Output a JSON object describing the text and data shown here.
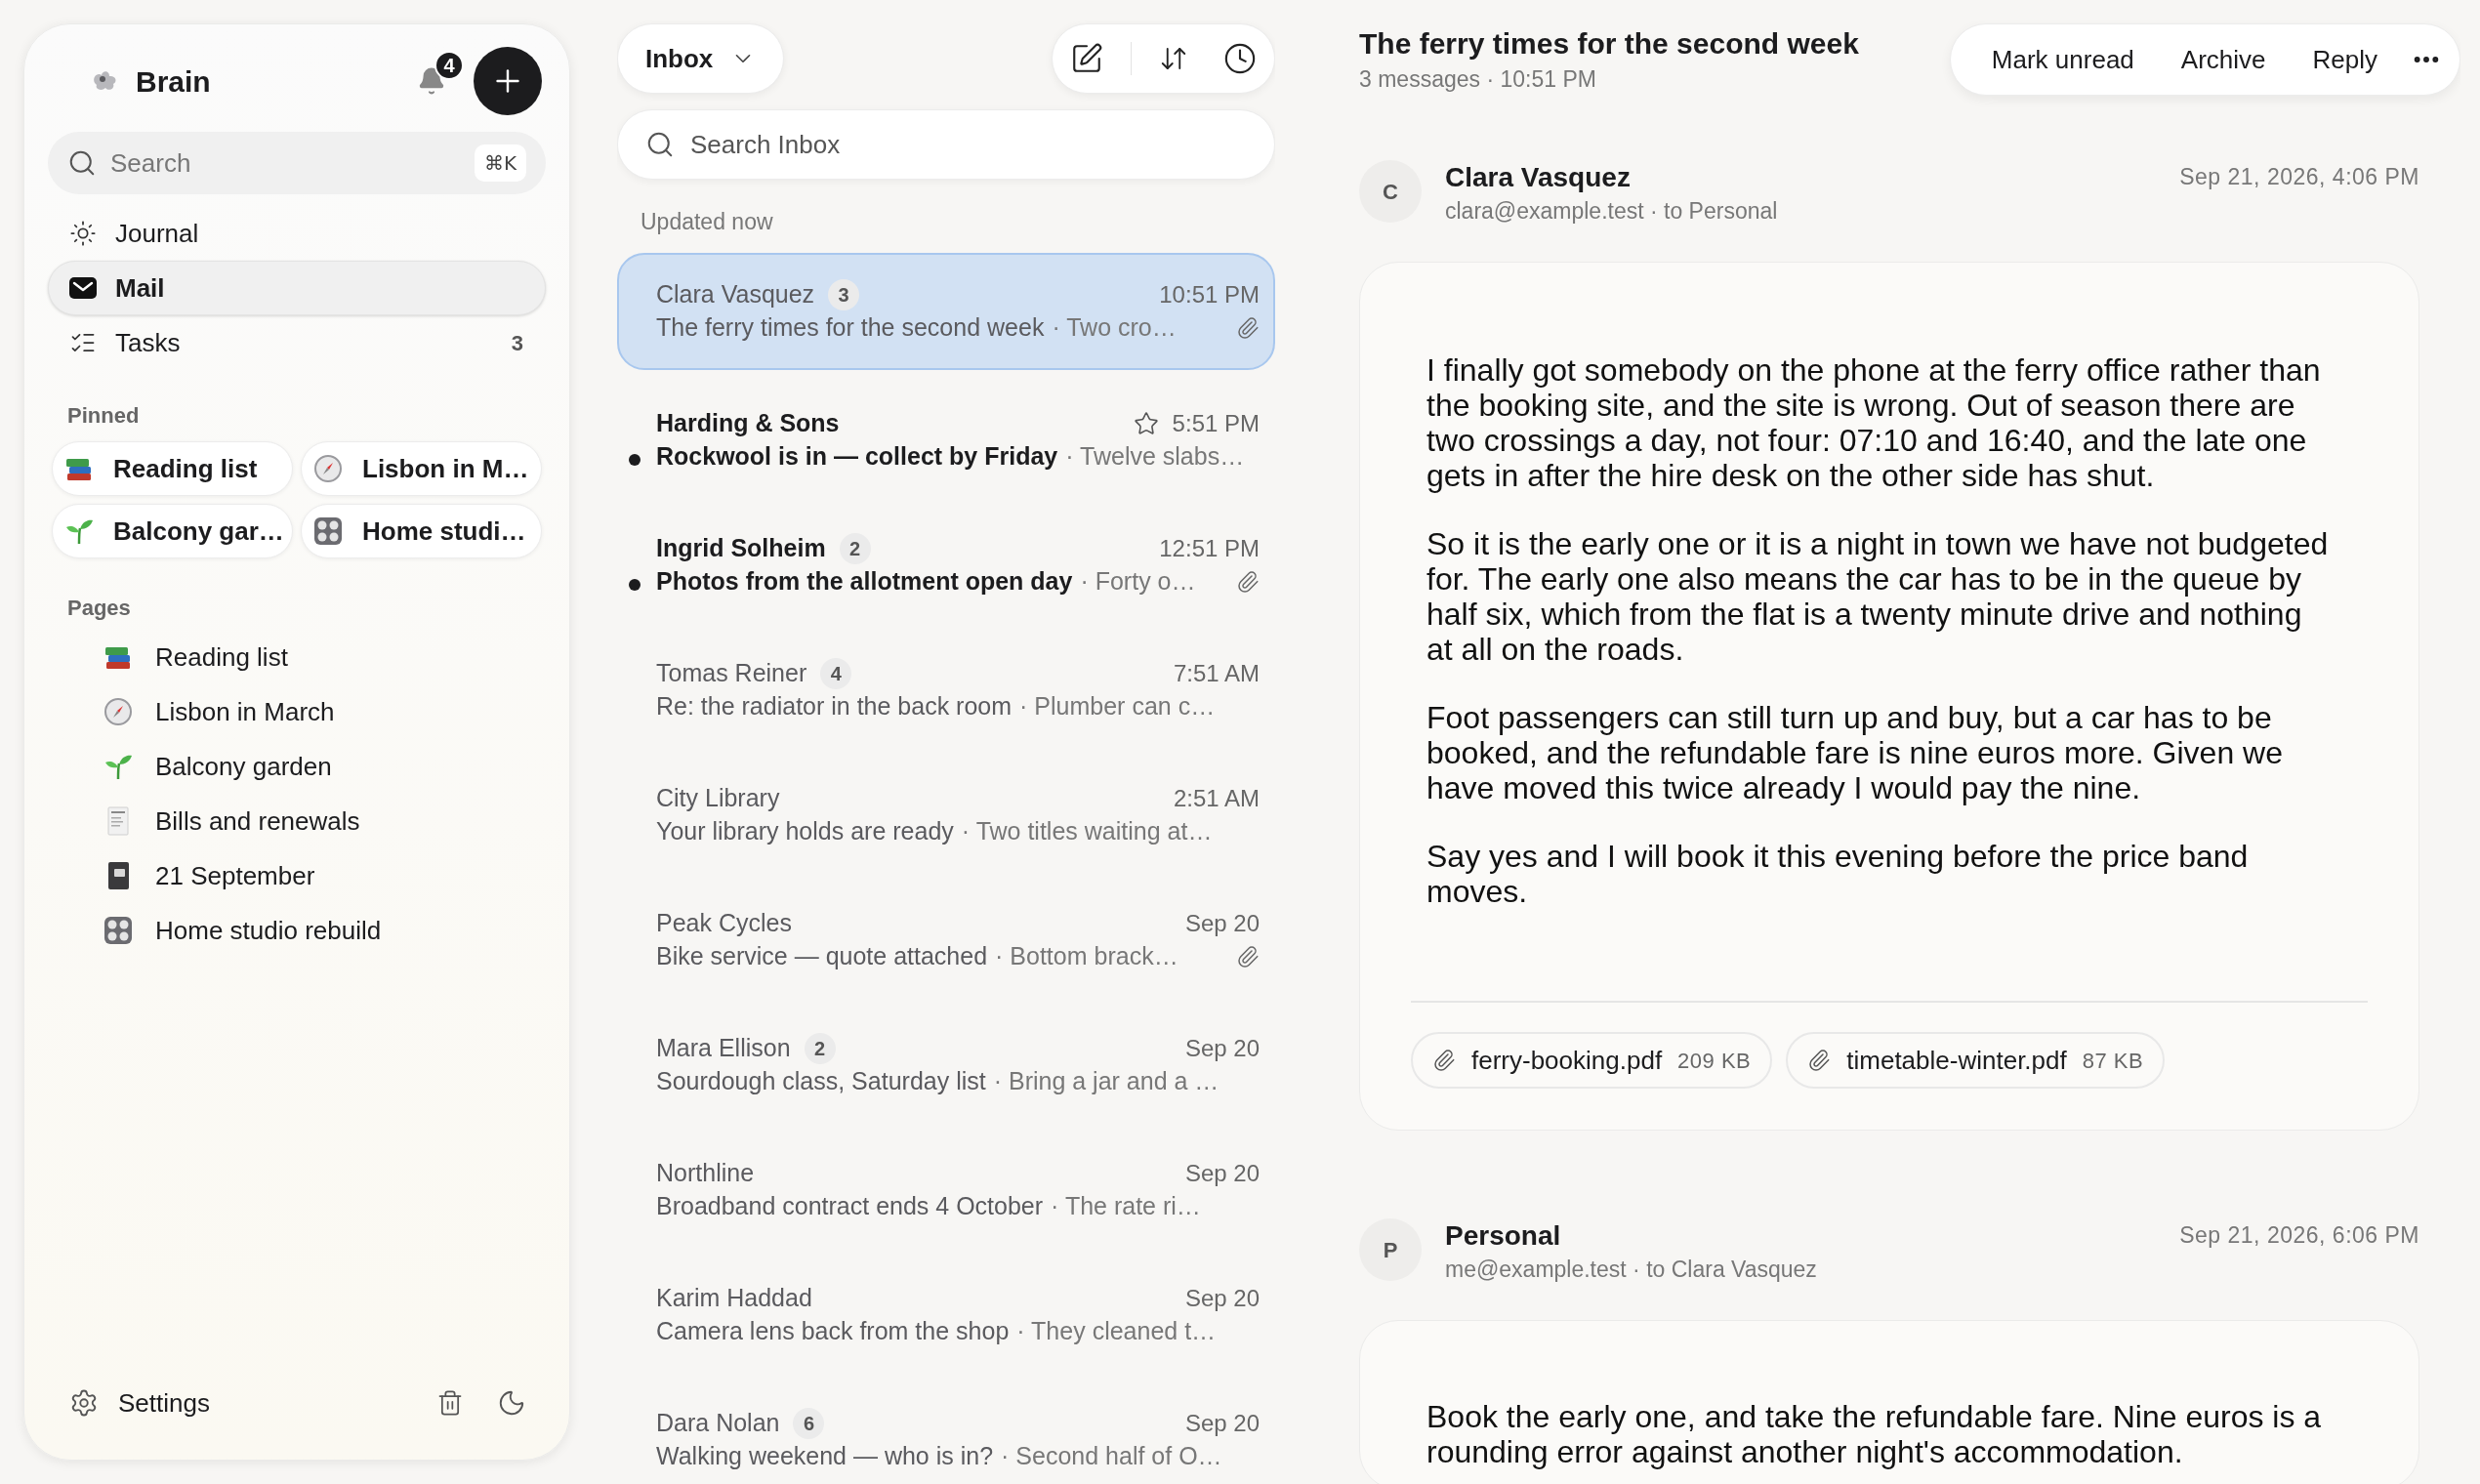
{
  "sidebar": {
    "app_name": "Brain",
    "notification_count": "4",
    "search": {
      "placeholder": "Search",
      "shortcut": "⌘K"
    },
    "nav": [
      {
        "label": "Journal",
        "selected": false
      },
      {
        "label": "Mail",
        "selected": true
      },
      {
        "label": "Tasks",
        "selected": false,
        "count": "3"
      }
    ],
    "pinned": {
      "heading": "Pinned",
      "items": [
        "Reading list",
        "Lisbon in M…",
        "Balcony gar…",
        "Home studi…"
      ]
    },
    "pages": {
      "heading": "Pages",
      "items": [
        "Reading list",
        "Lisbon in March",
        "Balcony garden",
        "Bills and renewals",
        "21 September",
        "Home studio rebuild"
      ]
    },
    "settings": "Settings"
  },
  "mail_list": {
    "mailbox": "Inbox",
    "search": {
      "placeholder": "Search Inbox"
    },
    "status": "Updated now",
    "messages": [
      {
        "sender": "Clara Vasquez",
        "count": "3",
        "time": "10:51 PM",
        "subject": "The ferry times for the second week",
        "preview": "· Two cro…",
        "unread": false,
        "starred": false,
        "attachment": true,
        "selected": true
      },
      {
        "sender": "Harding & Sons",
        "time": "5:51 PM",
        "subject": "Rockwool is in — collect by Friday",
        "preview": "· Twelve slabs…",
        "unread": true,
        "starred": true,
        "attachment": false,
        "selected": false
      },
      {
        "sender": "Ingrid Solheim",
        "count": "2",
        "time": "12:51 PM",
        "subject": "Photos from the allotment open day",
        "preview": "· Forty o…",
        "unread": true,
        "starred": false,
        "attachment": true,
        "selected": false
      },
      {
        "sender": "Tomas Reiner",
        "count": "4",
        "time": "7:51 AM",
        "subject": "Re: the radiator in the back room",
        "preview": "· Plumber can c…",
        "unread": false,
        "starred": false,
        "attachment": false,
        "selected": false
      },
      {
        "sender": "City Library",
        "time": "2:51 AM",
        "subject": "Your library holds are ready",
        "preview": "· Two titles waiting at…",
        "unread": false,
        "starred": false,
        "attachment": false,
        "selected": false
      },
      {
        "sender": "Peak Cycles",
        "time": "Sep 20",
        "subject": "Bike service — quote attached",
        "preview": "· Bottom brack…",
        "unread": false,
        "starred": false,
        "attachment": true,
        "selected": false
      },
      {
        "sender": "Mara Ellison",
        "count": "2",
        "time": "Sep 20",
        "subject": "Sourdough class, Saturday list",
        "preview": "· Bring a jar and a …",
        "unread": false,
        "starred": false,
        "attachment": false,
        "selected": false
      },
      {
        "sender": "Northline",
        "time": "Sep 20",
        "subject": "Broadband contract ends 4 October",
        "preview": "· The rate ri…",
        "unread": false,
        "starred": false,
        "attachment": false,
        "selected": false
      },
      {
        "sender": "Karim Haddad",
        "time": "Sep 20",
        "subject": "Camera lens back from the shop",
        "preview": "· They cleaned t…",
        "unread": false,
        "starred": false,
        "attachment": false,
        "selected": false
      },
      {
        "sender": "Dara Nolan",
        "count": "6",
        "time": "Sep 20",
        "subject": "Walking weekend — who is in?",
        "preview": "· Second half of O…",
        "unread": false,
        "starred": false,
        "attachment": false,
        "selected": false
      }
    ]
  },
  "thread": {
    "subject": "The ferry times for the second week",
    "meta": "3 messages · 10:51 PM",
    "actions": [
      "Mark unread",
      "Archive",
      "Reply"
    ],
    "messages": [
      {
        "initial": "C",
        "sender": "Clara Vasquez",
        "address": "clara@example.test · to Personal",
        "date": "Sep 21, 2026, 4:06 PM",
        "paragraphs": [
          "I finally got somebody on the phone at the ferry office rather than the booking site, and the site is wrong. Out of season there are two crossings a day, not four: 07:10 and 16:40, and the late one gets in after the hire desk on the other side has shut.",
          "So it is the early one or it is a night in town we have not budgeted for. The early one also means the car has to be in the queue by half six, which from the flat is a twenty minute drive and nothing at all on the roads.",
          "Foot passengers can still turn up and buy, but a car has to be booked, and the refundable fare is nine euros more. Given we have moved this twice already I would pay the nine.",
          "Say yes and I will book it this evening before the price band moves."
        ],
        "attachments": [
          {
            "name": "ferry-booking.pdf",
            "size": "209 KB"
          },
          {
            "name": "timetable-winter.pdf",
            "size": "87 KB"
          }
        ]
      },
      {
        "initial": "P",
        "sender": "Personal",
        "address": "me@example.test · to Clara Vasquez",
        "date": "Sep 21, 2026, 6:06 PM",
        "paragraphs": [
          "Book the early one, and take the refundable fare. Nine euros is a rounding error against another night's accommodation."
        ]
      }
    ]
  }
}
